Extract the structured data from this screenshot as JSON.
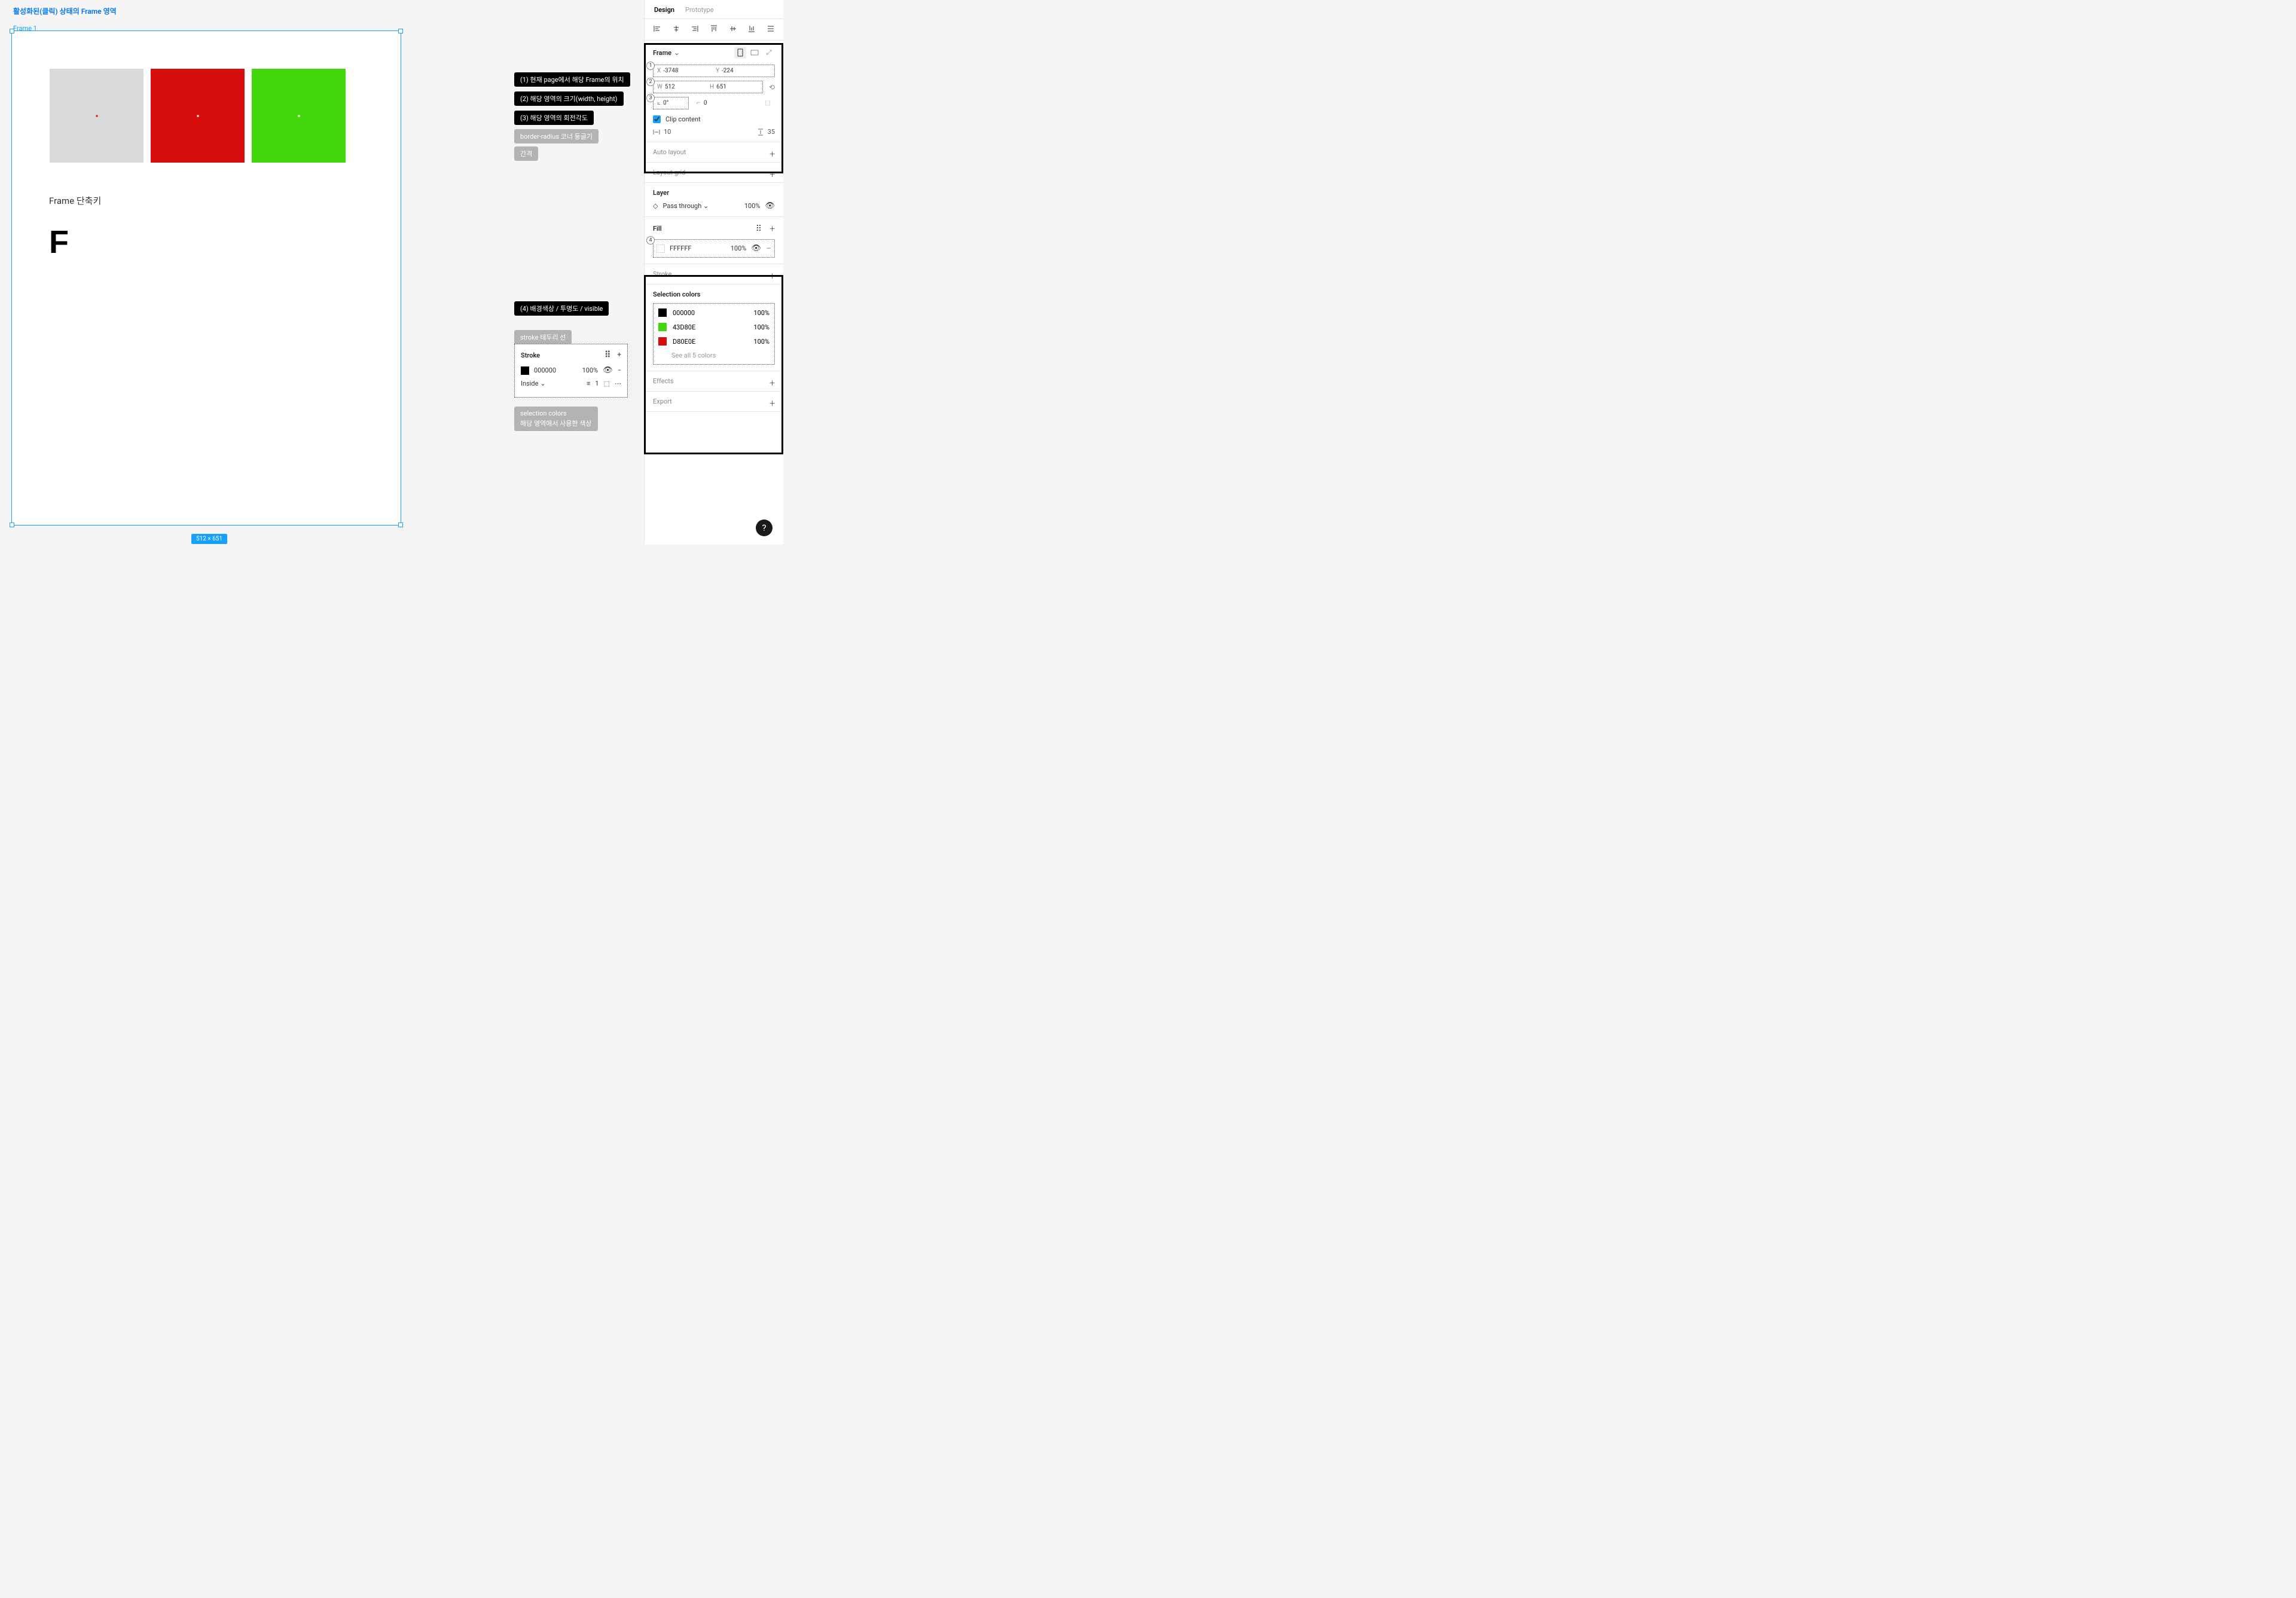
{
  "page_title": "활성화된(클릭) 상태의 Frame 영역",
  "frame_label": "Frame 1",
  "size_badge": "512 × 651",
  "shortcut_text": "Frame 단축키",
  "big_f": "F",
  "annotations": {
    "a1": "(1) 현재 page에서 해당 Frame의 위치",
    "a2": "(2) 해당 영역의 크기(width, height)",
    "a3": "(3) 해당 영역의 회전각도",
    "a4": "border-radius 코너 둥글기",
    "a5": "간격",
    "a6": "(4) 배경색상 / 투명도 / visible",
    "a7": "stroke 테두리 선",
    "a8a": "selection colors",
    "a8b": "해당 영역에서 사용한 색상"
  },
  "stroke_box": {
    "title": "Stroke",
    "color": "000000",
    "opacity": "100%",
    "position": "Inside",
    "width": "1"
  },
  "tabs": {
    "design": "Design",
    "prototype": "Prototype"
  },
  "frame_section": {
    "title": "Frame",
    "badges": {
      "b1": "1",
      "b2": "2",
      "b3": "3"
    },
    "x_label": "X",
    "x_val": "-3748",
    "y_label": "Y",
    "y_val": "-224",
    "w_label": "W",
    "w_val": "512",
    "h_label": "H",
    "h_val": "651",
    "rot_val": "0°",
    "rad_val": "0",
    "clip": "Clip content",
    "sp1": "10",
    "sp2": "35"
  },
  "auto_layout": "Auto layout",
  "layout_grid": "Layout grid",
  "layer": {
    "title": "Layer",
    "mode": "Pass through",
    "pct": "100%"
  },
  "fill": {
    "title": "Fill",
    "badge": "4",
    "color": "FFFFFF",
    "pct": "100%"
  },
  "stroke_title": "Stroke",
  "selection": {
    "title": "Selection colors",
    "c1": {
      "hex": "000000",
      "pct": "100%",
      "color": "#000000"
    },
    "c2": {
      "hex": "43D80E",
      "pct": "100%",
      "color": "#43d80e"
    },
    "c3": {
      "hex": "D80E0E",
      "pct": "100%",
      "color": "#d80e0e"
    },
    "see_all": "See all 5 colors"
  },
  "effects": "Effects",
  "export": "Export",
  "help": "?"
}
